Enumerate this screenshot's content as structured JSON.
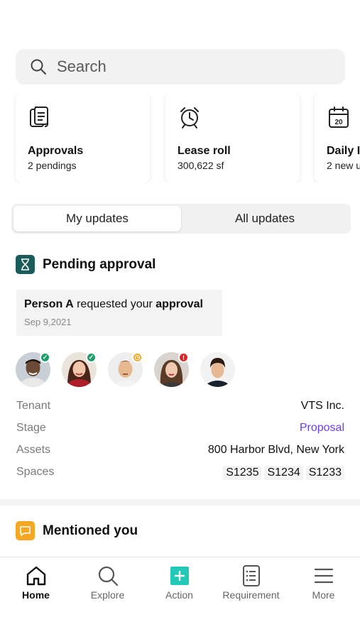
{
  "search": {
    "placeholder": "Search"
  },
  "cards": [
    {
      "title": "Approvals",
      "subtitle": "2 pendings",
      "icon": "document-stack-icon"
    },
    {
      "title": "Lease roll",
      "subtitle": "300,622 sf",
      "icon": "alarm-clock-icon"
    },
    {
      "title": "Daily I",
      "subtitle": "2 new u",
      "icon": "calendar-icon",
      "calendar_day": "20"
    }
  ],
  "segments": {
    "my_updates": "My updates",
    "all_updates": "All updates",
    "active": "my_updates"
  },
  "pending": {
    "title": "Pending approval",
    "requester": "Person A",
    "action_text": " requested your ",
    "action_strong": "approval",
    "date": "Sep 9,2021",
    "approvers": [
      {
        "status": "approved"
      },
      {
        "status": "approved"
      },
      {
        "status": "pending"
      },
      {
        "status": "rejected"
      },
      {
        "status": "none"
      }
    ],
    "details": {
      "tenant_label": "Tenant",
      "tenant_value": "VTS Inc.",
      "stage_label": "Stage",
      "stage_value": "Proposal",
      "assets_label": "Assets",
      "assets_value": "800 Harbor Blvd, New York",
      "spaces_label": "Spaces",
      "spaces": [
        "S1235",
        "S1234",
        "S1233"
      ]
    }
  },
  "mentioned": {
    "title": "Mentioned you"
  },
  "tabs": [
    {
      "label": "Home",
      "icon": "home-icon",
      "active": true
    },
    {
      "label": "Explore",
      "icon": "search-icon"
    },
    {
      "label": "Action",
      "icon": "plus-square-icon"
    },
    {
      "label": "Requirement",
      "icon": "list-document-icon"
    },
    {
      "label": "More",
      "icon": "menu-icon"
    }
  ],
  "colors": {
    "accent": "#6a3ef0",
    "teal": "#1a5b5b",
    "action": "#22c9b8",
    "mention": "#f5a623",
    "approved": "#1e9e6a",
    "pending": "#f5a623",
    "rejected": "#e02424"
  }
}
